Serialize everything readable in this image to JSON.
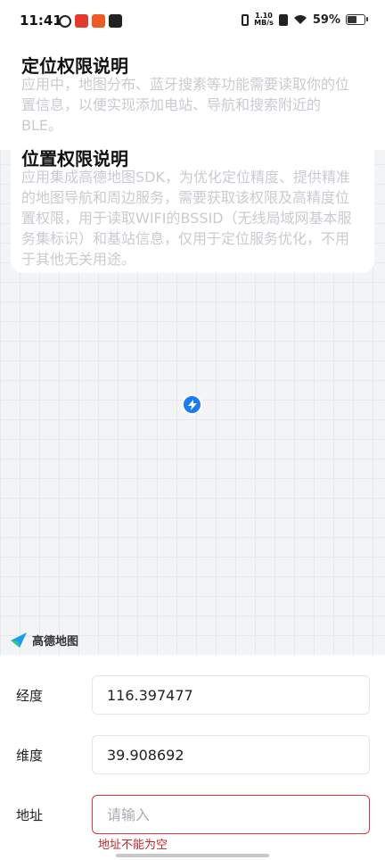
{
  "status_bar": {
    "time": "11:41",
    "net_speed_value": "1.10",
    "net_speed_unit": "MB/s",
    "battery": "59%",
    "battery_level": 0.59
  },
  "permissions": [
    {
      "title": "定位权限说明",
      "text": "应用中，地图分布、蓝牙搜素等功能需要读取你的位置信息，以便实现添加电站、导航和搜索附近的BLE。"
    },
    {
      "title": "位置权限说明",
      "text": "应用集成高德地图SDK，为优化定位精度、提供精准的地图导航和周边服务，需要获取该权限及高精度位置权限，用于读取WIFI的BSSID（无线局域网基本服务集标识）和基站信息，仅用于定位服务优化，不用于其他无关用途。"
    }
  ],
  "map": {
    "logo_text": "高德地图",
    "pin_icon": "location-marker-icon",
    "accent": "#1a7cf0"
  },
  "form": {
    "longitude_label": "经度",
    "longitude_value": "116.397477",
    "latitude_label": "维度",
    "latitude_value": "39.908692",
    "address_label": "地址",
    "address_value": "",
    "address_placeholder": "请输入",
    "address_error": "地址不能为空",
    "error_color": "#d9363e"
  }
}
